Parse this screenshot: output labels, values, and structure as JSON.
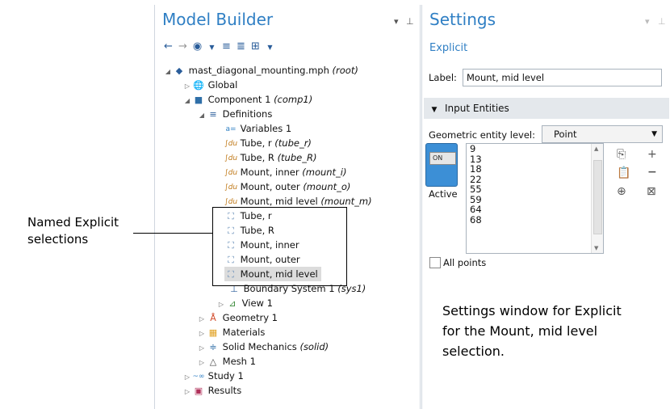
{
  "model_builder": {
    "title": "Model Builder",
    "tree": [
      {
        "label": "mast_diagonal_mounting.mph",
        "tag": "(root)"
      },
      {
        "label": "Global",
        "tag": ""
      },
      {
        "label": "Component 1",
        "tag": "(comp1)"
      },
      {
        "label": "Definitions",
        "tag": ""
      },
      {
        "label": "Variables 1",
        "tag": ""
      },
      {
        "label": "Tube, r",
        "tag": "(tube_r)"
      },
      {
        "label": "Tube, R",
        "tag": "(tube_R)"
      },
      {
        "label": "Mount, inner",
        "tag": "(mount_i)"
      },
      {
        "label": "Mount, outer",
        "tag": "(mount_o)"
      },
      {
        "label": "Mount, mid level",
        "tag": "(mount_m)"
      },
      {
        "label": "Tube, r",
        "tag": ""
      },
      {
        "label": "Tube, R",
        "tag": ""
      },
      {
        "label": "Mount, inner",
        "tag": ""
      },
      {
        "label": "Mount, outer",
        "tag": ""
      },
      {
        "label": "Mount, mid level",
        "tag": ""
      },
      {
        "label": "Boundary System 1",
        "tag": "(sys1)"
      },
      {
        "label": "View 1",
        "tag": ""
      },
      {
        "label": "Geometry 1",
        "tag": ""
      },
      {
        "label": "Materials",
        "tag": ""
      },
      {
        "label": "Solid Mechanics",
        "tag": "(solid)"
      },
      {
        "label": "Mesh 1",
        "tag": ""
      },
      {
        "label": "Study 1",
        "tag": ""
      },
      {
        "label": "Results",
        "tag": ""
      }
    ]
  },
  "settings": {
    "title": "Settings",
    "subtitle": "Explicit",
    "label_caption": "Label:",
    "label_value": "Mount, mid level",
    "section": "Input Entities",
    "entity_level_caption": "Geometric entity level:",
    "entity_level_value": "Point",
    "toggle_text": "ON",
    "active_label": "Active",
    "entities": [
      "9",
      "13",
      "18",
      "22",
      "55",
      "59",
      "64",
      "68"
    ],
    "all_points_label": "All points"
  },
  "annotations": {
    "left_line1": "Named Explicit",
    "left_line2": "selections",
    "right_line1": "Settings window for Explicit",
    "right_line2": "for the Mount, mid level",
    "right_line3": "selection."
  },
  "colors": {
    "accent": "#2f7fc4",
    "toggle_on": "#3c8fd6",
    "selection_bg": "#dcdcdc"
  }
}
